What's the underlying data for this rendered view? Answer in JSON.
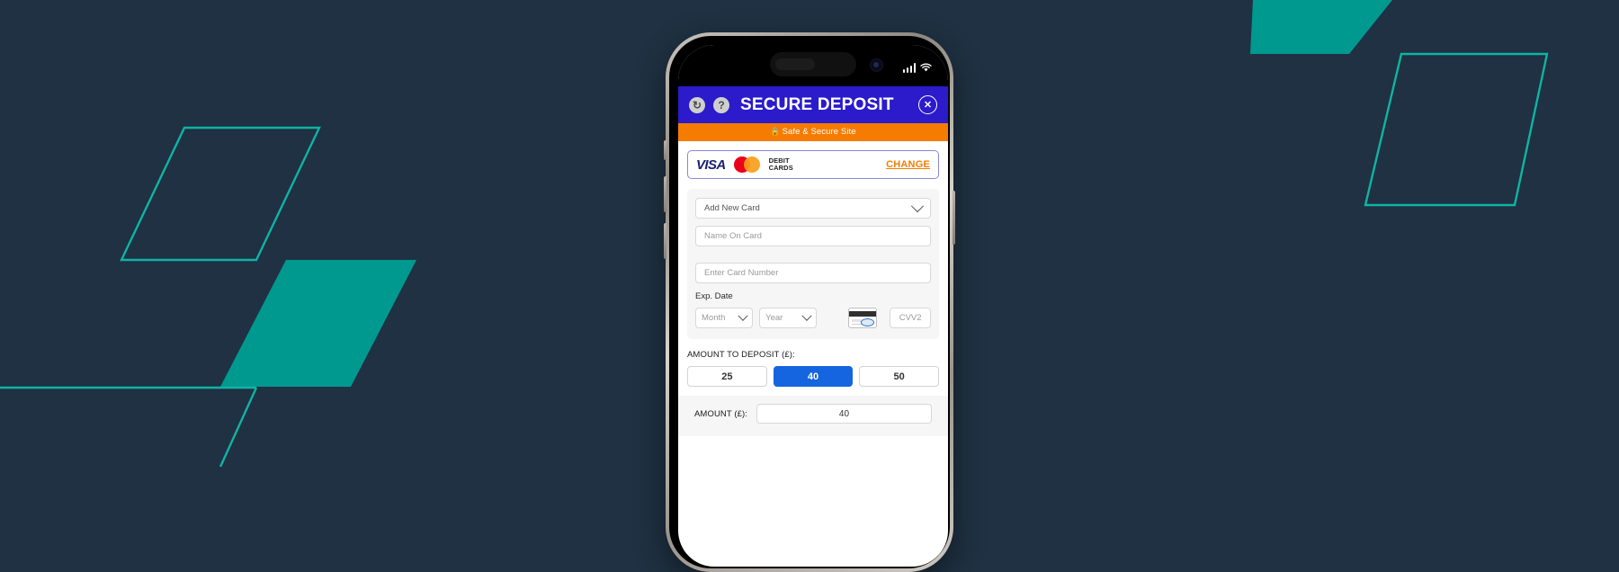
{
  "background": {
    "color": "#1f3142",
    "accent_fill": "#00998F",
    "accent_stroke": "#0FB3A4"
  },
  "phone": {
    "status_bar": {
      "signal_icon": "cellular-signal-icon",
      "wifi_icon": "wifi-icon",
      "camera_icon": "front-camera-icon"
    }
  },
  "app": {
    "header": {
      "title": "SECURE DEPOSIT",
      "history_icon": "refresh-history-icon",
      "history_glyph": "↻",
      "help_icon": "help-question-icon",
      "help_glyph": "?",
      "close_icon": "close-x-icon",
      "close_glyph": "✕",
      "bg_color": "#2B1BCB"
    },
    "secure_banner": {
      "text": "Safe & Secure Site",
      "lock_glyph": "🔒",
      "bg_color": "#F57C00"
    },
    "brands": {
      "visa_label": "VISA",
      "mastercard_icon": "mastercard-logo-icon",
      "debit_line1": "DEBIT",
      "debit_line2": "CARDS",
      "change_label": "CHANGE",
      "change_color": "#F57C00"
    },
    "card_form": {
      "card_select_value": "Add New Card",
      "name_placeholder": "Name On Card",
      "number_placeholder": "Enter Card Number",
      "exp_label": "Exp. Date",
      "month_placeholder": "Month",
      "year_placeholder": "Year",
      "cvv_card_icon": "card-back-cvv-icon",
      "cvv_placeholder": "CVV2"
    },
    "deposit": {
      "label": "AMOUNT TO DEPOSIT (£):",
      "chips": [
        {
          "value": "25",
          "selected": false
        },
        {
          "value": "40",
          "selected": true
        },
        {
          "value": "50",
          "selected": false
        }
      ],
      "amount_label": "AMOUNT (£):",
      "amount_value": "40",
      "active_color": "#1565E0"
    }
  }
}
